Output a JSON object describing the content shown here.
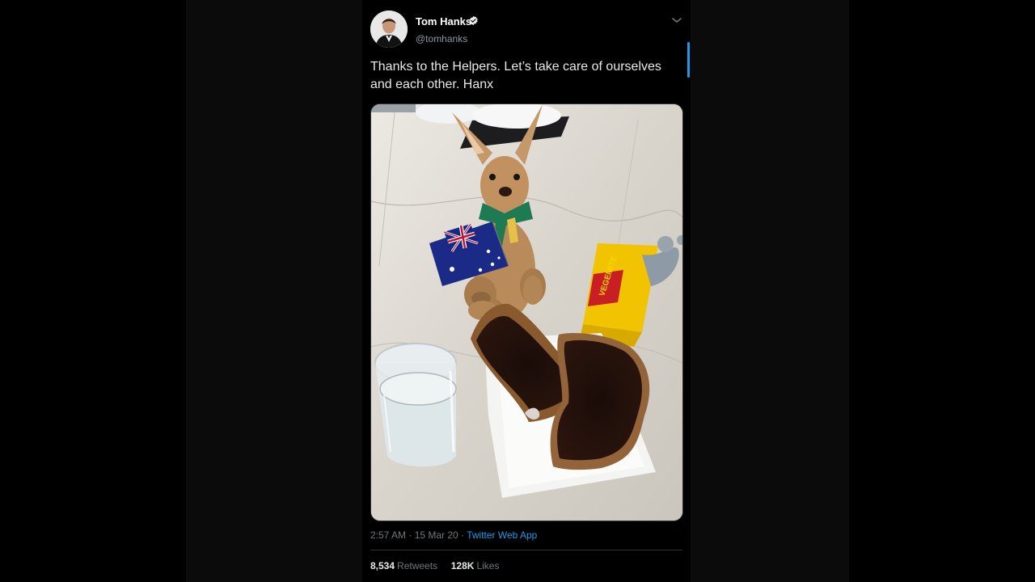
{
  "tweet": {
    "author": {
      "display_name": "Tom Hanks",
      "handle": "@tomhanks",
      "verified": true
    },
    "text": "Thanks to the Helpers. Let’s take care of ourselves and each other. Hanx",
    "meta": {
      "time": "2:57 AM",
      "sep1": " · ",
      "date": "15 Mar 20",
      "sep2": " · ",
      "source": "Twitter Web App"
    },
    "stats": {
      "retweets_count": "8,534",
      "retweets_label": "Retweets",
      "likes_count": "128K",
      "likes_label": "Likes"
    },
    "media_logo_text": "VEGEMITE"
  },
  "colors": {
    "background": "#000000",
    "panel": "#0b0b0b",
    "accent": "#1d9bf0",
    "text": "#e7e9ea",
    "muted": "#71767b"
  },
  "icons": [
    "verified-icon",
    "chevron-down-icon"
  ]
}
